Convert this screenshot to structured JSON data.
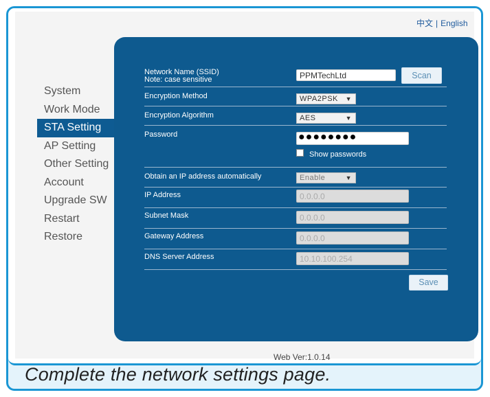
{
  "lang": {
    "chinese": "中文",
    "separator": "|",
    "english": "English"
  },
  "sidebar": {
    "items": [
      {
        "label": "System"
      },
      {
        "label": "Work Mode"
      },
      {
        "label": "STA Setting"
      },
      {
        "label": "AP Setting"
      },
      {
        "label": "Other Setting"
      },
      {
        "label": "Account"
      },
      {
        "label": "Upgrade SW"
      },
      {
        "label": "Restart"
      },
      {
        "label": "Restore"
      }
    ],
    "active": "STA Setting"
  },
  "form": {
    "ssid_label": "Network Name (SSID)",
    "ssid_note": "Note: case sensitive",
    "ssid_value": "PPMTechLtd",
    "scan_label": "Scan",
    "encryption_method_label": "Encryption Method",
    "encryption_method_value": "WPA2PSK",
    "encryption_algorithm_label": "Encryption Algorithm",
    "encryption_algorithm_value": "AES",
    "password_label": "Password",
    "password_mask": "●●●●●●●●",
    "show_passwords_label": "Show passwords",
    "obtain_ip_label": "Obtain an IP address automatically",
    "obtain_ip_value": "Enable",
    "ip_label": "IP Address",
    "ip_value": "0.0.0.0",
    "subnet_label": "Subnet Mask",
    "subnet_value": "0.0.0.0",
    "gateway_label": "Gateway Address",
    "gateway_value": "0.0.0.0",
    "dns_label": "DNS Server Address",
    "dns_value": "10.10.100.254",
    "save_label": "Save"
  },
  "footer": {
    "version": "Web Ver:1.0.14"
  },
  "caption": "Complete the network settings page."
}
